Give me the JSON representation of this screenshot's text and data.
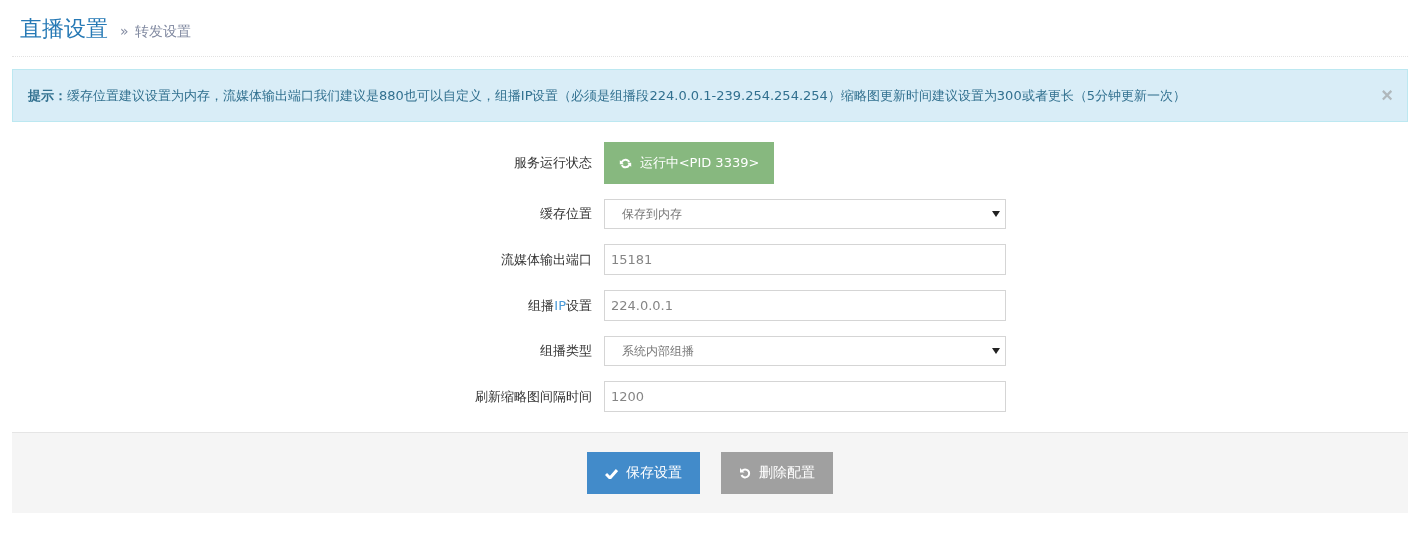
{
  "header": {
    "title": "直播设置",
    "breadcrumb_sep": "»",
    "subtitle": "转发设置"
  },
  "alert": {
    "label": "提示：",
    "text": "缓存位置建议设置为内存，流媒体输出端口我们建议是880也可以自定义，组播IP设置（必须是组播段224.0.0.1-239.254.254.254）缩略图更新时间建议设置为300或者更长（5分钟更新一次）",
    "close": "×"
  },
  "fields": [
    {
      "kind": "status",
      "label": [
        {
          "text": "服务运行状态",
          "accent": false
        }
      ],
      "value": "运行中<PID 3339>"
    },
    {
      "kind": "select",
      "label": [
        {
          "text": "缓存位置",
          "accent": false
        }
      ],
      "value": "保存到内存"
    },
    {
      "kind": "input",
      "label": [
        {
          "text": "流媒体输出端口",
          "accent": false
        }
      ],
      "value": "15181"
    },
    {
      "kind": "input",
      "label": [
        {
          "text": "组播",
          "accent": false
        },
        {
          "text": "IP",
          "accent": true
        },
        {
          "text": "设置",
          "accent": false
        }
      ],
      "value": "224.0.0.1"
    },
    {
      "kind": "select",
      "label": [
        {
          "text": "组播类型",
          "accent": false
        }
      ],
      "value": "系统内部组播"
    },
    {
      "kind": "input",
      "label": [
        {
          "text": "刷新缩略图间隔时间",
          "accent": false
        }
      ],
      "value": "1200"
    }
  ],
  "actions": [
    {
      "kind": "save",
      "label": "保存设置"
    },
    {
      "kind": "reset",
      "label": "删除配置"
    }
  ]
}
